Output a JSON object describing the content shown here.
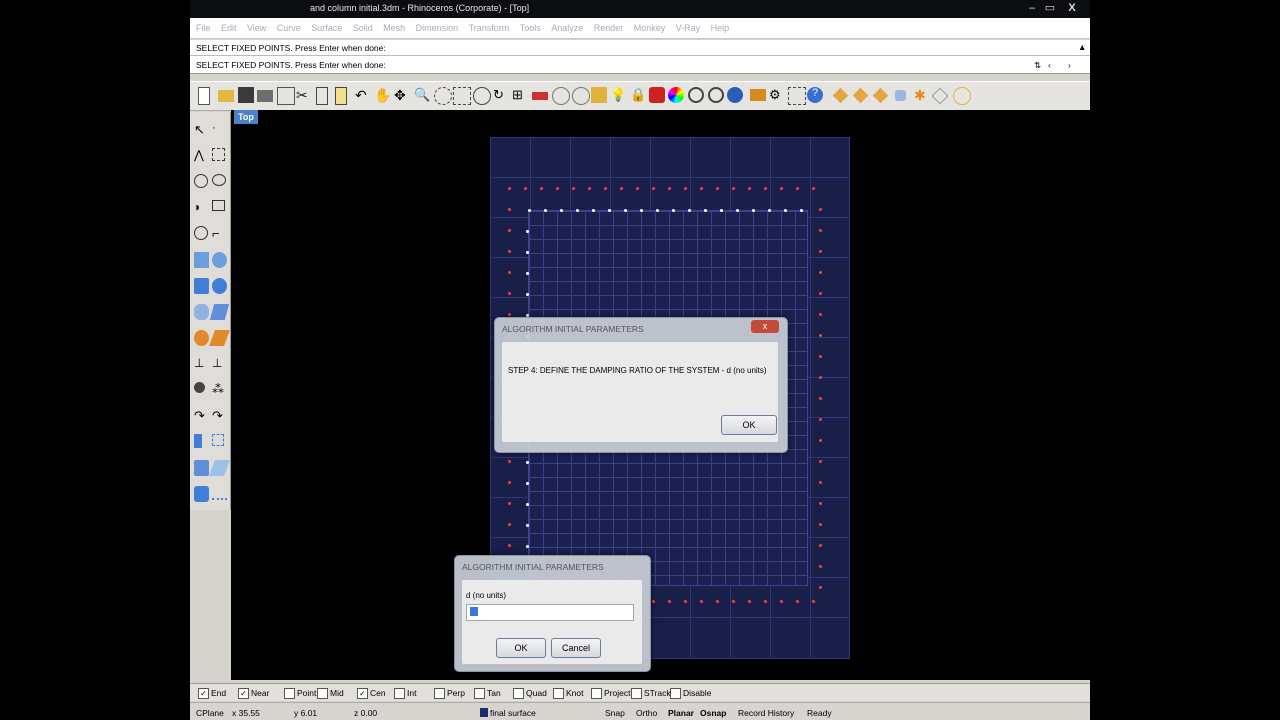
{
  "window": {
    "title": "and column initial.3dm - Rhinoceros (Corporate) - [Top]",
    "controls": [
      "–",
      "▭",
      "X"
    ]
  },
  "menu": [
    "File",
    "Edit",
    "View",
    "Curve",
    "Surface",
    "Solid",
    "Mesh",
    "Dimension",
    "Transform",
    "Tools",
    "Analyze",
    "Render",
    "Monkey",
    "V-Ray",
    "Help"
  ],
  "command": {
    "history": "SELECT FIXED POINTS. Press Enter when done:",
    "prompt": "SELECT FIXED POINTS. Press Enter when done:"
  },
  "viewport": {
    "label": "Top"
  },
  "dialog_main": {
    "title": "ALGORITHM INITIAL PARAMETERS",
    "close": "x",
    "message": "STEP 4:  DEFINE THE DAMPING RATIO OF THE SYSTEM - d (no units)",
    "ok": "OK"
  },
  "dialog_input": {
    "title": "ALGORITHM INITIAL PARAMETERS",
    "field_label": "d (no units)",
    "field_value": "",
    "ok": "OK",
    "cancel": "Cancel"
  },
  "osnap": [
    {
      "label": "End",
      "checked": true
    },
    {
      "label": "Near",
      "checked": true
    },
    {
      "label": "Point",
      "checked": false
    },
    {
      "label": "Mid",
      "checked": false
    },
    {
      "label": "Cen",
      "checked": true
    },
    {
      "label": "Int",
      "checked": false
    },
    {
      "label": "Perp",
      "checked": false
    },
    {
      "label": "Tan",
      "checked": false
    },
    {
      "label": "Quad",
      "checked": false
    },
    {
      "label": "Knot",
      "checked": false
    },
    {
      "label": "Project",
      "checked": false
    },
    {
      "label": "STrack",
      "checked": false
    },
    {
      "label": "Disable",
      "checked": false
    }
  ],
  "status": {
    "cplane": "CPlane",
    "x": "x 35.55",
    "y": "y 6.01",
    "z": "z 0.00",
    "layer": "final surface",
    "snap": "Snap",
    "ortho": "Ortho",
    "planar": "Planar",
    "osnap": "Osnap",
    "record": "Record History",
    "ready": "Ready"
  },
  "colors": {
    "accent": "#4a82c5",
    "point_red": "#ff3b3b",
    "point_white": "#ffffff",
    "grid": "#1a1f4a"
  }
}
